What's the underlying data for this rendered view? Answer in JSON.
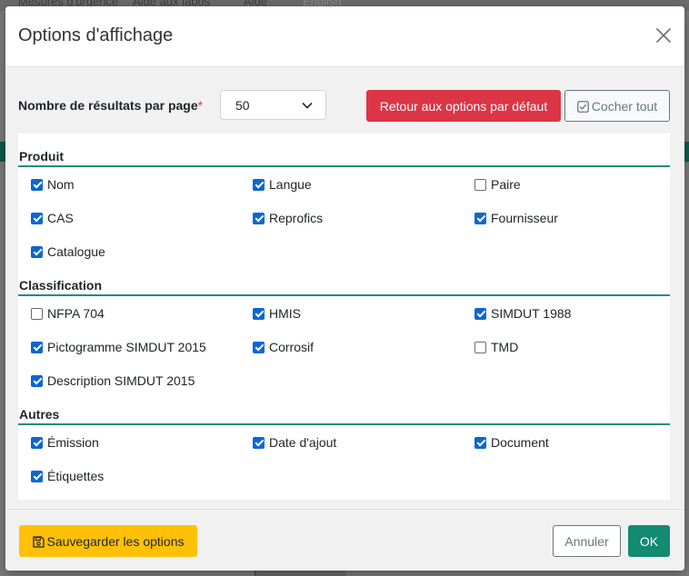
{
  "background": {
    "nav_items": [
      "Mesures d'urgence",
      "Aide aux labos",
      "Aide",
      "English"
    ]
  },
  "modal": {
    "title": "Options d'affichage",
    "results_per_page": {
      "label": "Nombre de résultats par page",
      "required_marker": "*",
      "value": "50"
    },
    "reset_button": "Retour aux options par défaut",
    "check_all_button": "Cocher tout",
    "sections": [
      {
        "title": "Produit",
        "options": [
          {
            "label": "Nom",
            "checked": true
          },
          {
            "label": "Langue",
            "checked": true
          },
          {
            "label": "Paire",
            "checked": false
          },
          {
            "label": "CAS",
            "checked": true
          },
          {
            "label": "Reprofics",
            "checked": true
          },
          {
            "label": "Fournisseur",
            "checked": true
          },
          {
            "label": "Catalogue",
            "checked": true
          }
        ]
      },
      {
        "title": "Classification",
        "options": [
          {
            "label": "NFPA 704",
            "checked": false
          },
          {
            "label": "HMIS",
            "checked": true
          },
          {
            "label": "SIMDUT 1988",
            "checked": true
          },
          {
            "label": "Pictogramme SIMDUT 2015",
            "checked": true
          },
          {
            "label": "Corrosif",
            "checked": true
          },
          {
            "label": "TMD",
            "checked": false
          },
          {
            "label": "Description SIMDUT 2015",
            "checked": true
          }
        ]
      },
      {
        "title": "Autres",
        "options": [
          {
            "label": "Émission",
            "checked": true
          },
          {
            "label": "Date d'ajout",
            "checked": true
          },
          {
            "label": "Document",
            "checked": true
          },
          {
            "label": "Étiquettes",
            "checked": true
          }
        ]
      }
    ],
    "footer": {
      "save_button": "Sauvegarder les options",
      "cancel_button": "Annuler",
      "ok_button": "OK"
    },
    "colors": {
      "accent_rule": "#1f8f7c",
      "danger": "#dc3545",
      "warning": "#ffc107",
      "success": "#138a72",
      "checkbox": "#0b66d3"
    }
  }
}
